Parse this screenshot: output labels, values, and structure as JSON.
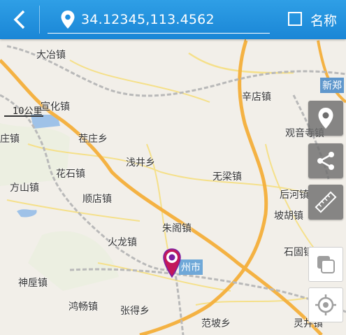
{
  "header": {
    "coordinates": "34.12345,113.4562",
    "name_label": "名称"
  },
  "map": {
    "scale_label": "10公里",
    "places": [
      {
        "id": "dayezhen",
        "label": "大冶镇"
      },
      {
        "id": "xuanhuazhen",
        "label": "宣化镇"
      },
      {
        "id": "xindianzhen",
        "label": "辛店镇"
      },
      {
        "id": "guanyinsizhen",
        "label": "观音寺镇"
      },
      {
        "id": "zhuangzhen",
        "label": "庄镇"
      },
      {
        "id": "chazhuangxiang",
        "label": "茬庄乡"
      },
      {
        "id": "qianjingxiang",
        "label": "浅井乡"
      },
      {
        "id": "huashizhen",
        "label": "花石镇"
      },
      {
        "id": "wuliangzhen",
        "label": "无梁镇"
      },
      {
        "id": "houhezhen",
        "label": "后河镇"
      },
      {
        "id": "fangshanzhen",
        "label": "方山镇"
      },
      {
        "id": "shundianzhen",
        "label": "顺店镇"
      },
      {
        "id": "pohuzhen",
        "label": "坡胡镇"
      },
      {
        "id": "zhugezhen",
        "label": "朱阁镇"
      },
      {
        "id": "huolongzhen",
        "label": "火龙镇"
      },
      {
        "id": "shigu",
        "label": "石固镇"
      },
      {
        "id": "shenhouzhen",
        "label": "神垕镇"
      },
      {
        "id": "hongchangzhen",
        "label": "鸿畅镇"
      },
      {
        "id": "zhangdexiang",
        "label": "张得乡"
      },
      {
        "id": "fanpoxiang",
        "label": "范坡乡"
      },
      {
        "id": "lingjing",
        "label": "灵井镇"
      }
    ],
    "city_label": "州市",
    "xinzheng_label": "新郑"
  }
}
